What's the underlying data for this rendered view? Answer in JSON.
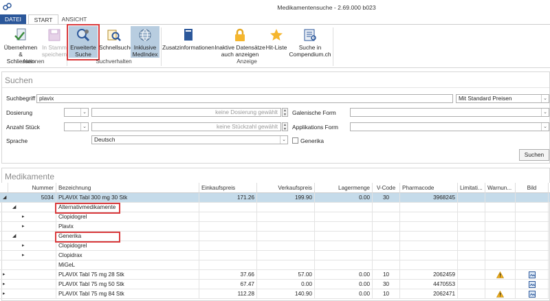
{
  "window": {
    "title": "Medikamentensuche - 2.69.000 b023"
  },
  "tabs": [
    {
      "label": "DATEI"
    },
    {
      "label": "START"
    },
    {
      "label": "ANSICHT"
    }
  ],
  "ribbon": {
    "buttons": [
      {
        "label1": "Übernehmen &",
        "label2": "Schliessen",
        "icon": "check-doc-icon"
      },
      {
        "label1": "In Stamm",
        "label2": "speichern",
        "icon": "save-icon"
      },
      {
        "label1": "Erweiterte",
        "label2": "Suche",
        "icon": "advanced-search-icon"
      },
      {
        "label1": "Schnellsuche",
        "label2": "",
        "icon": "quick-search-icon"
      },
      {
        "label1": "Inklusive",
        "label2": "MedIndex",
        "icon": "globe-icon"
      },
      {
        "label1": "Zusatzinformationen",
        "label2": "",
        "icon": "book-icon"
      },
      {
        "label1": "Inaktive Datensätze",
        "label2": "auch anzeigen",
        "icon": "lock-icon"
      },
      {
        "label1": "Hit-Liste",
        "label2": "",
        "icon": "star-icon"
      },
      {
        "label1": "Suche in",
        "label2": "Compendium.ch",
        "icon": "compendium-icon"
      }
    ],
    "groups": [
      {
        "label": "Aktionen"
      },
      {
        "label": "Suchverhalten"
      },
      {
        "label": "Anzeige"
      }
    ]
  },
  "search": {
    "title": "Suchen",
    "suchbegriff_label": "Suchbegriff",
    "suchbegriff_value": "plavix",
    "preis_value": "Mit Standard Preisen",
    "dosierung_label": "Dosierung",
    "dosierung_placeholder": "keine Dosierung gewählt",
    "anzahl_label": "Anzahl Stück",
    "anzahl_placeholder": "keine Stückzahl gewählt",
    "sprache_label": "Sprache",
    "sprache_value": "Deutsch",
    "galenische_label": "Galenische Form",
    "applikation_label": "Applikations Form",
    "generika_label": "Generika",
    "suchen_button": "Suchen"
  },
  "results": {
    "title": "Medikamente",
    "columns": [
      "Nummer",
      "Bezeichnung",
      "Einkaufspreis",
      "Verkaufspreis",
      "Lagermenge",
      "V-Code",
      "Pharmacode",
      "Limitati...",
      "Warnun...",
      "Bild"
    ],
    "rows": [
      {
        "expander": "◢",
        "nummer": "5034",
        "bez": "PLAVIX Tabl 300 mg 30 Stk",
        "ek": "171.26",
        "vk": "199.90",
        "lager": "0.00",
        "vcode": "30",
        "pharma": "3968245",
        "warn": "",
        "bild": "",
        "level": 0,
        "selected": true
      },
      {
        "expander": "◢",
        "nummer": "",
        "bez": "Alternativmedikamente",
        "ek": "",
        "vk": "",
        "lager": "",
        "vcode": "",
        "pharma": "",
        "warn": "",
        "bild": "",
        "level": 1
      },
      {
        "expander": "▸",
        "nummer": "",
        "bez": "Clopidogrel",
        "ek": "",
        "vk": "",
        "lager": "",
        "vcode": "",
        "pharma": "",
        "warn": "",
        "bild": "",
        "level": 2
      },
      {
        "expander": "▸",
        "nummer": "",
        "bez": "Plavix",
        "ek": "",
        "vk": "",
        "lager": "",
        "vcode": "",
        "pharma": "",
        "warn": "",
        "bild": "",
        "level": 2
      },
      {
        "expander": "◢",
        "nummer": "",
        "bez": "Generika",
        "ek": "",
        "vk": "",
        "lager": "",
        "vcode": "",
        "pharma": "",
        "warn": "",
        "bild": "",
        "level": 1
      },
      {
        "expander": "▸",
        "nummer": "",
        "bez": "Clopidogrel",
        "ek": "",
        "vk": "",
        "lager": "",
        "vcode": "",
        "pharma": "",
        "warn": "",
        "bild": "",
        "level": 2
      },
      {
        "expander": "▸",
        "nummer": "",
        "bez": "Clopidrax",
        "ek": "",
        "vk": "",
        "lager": "",
        "vcode": "",
        "pharma": "",
        "warn": "",
        "bild": "",
        "level": 2
      },
      {
        "expander": "",
        "nummer": "",
        "bez": "MiGeL",
        "ek": "",
        "vk": "",
        "lager": "",
        "vcode": "",
        "pharma": "",
        "warn": "",
        "bild": "",
        "level": 1
      },
      {
        "expander": "▸",
        "nummer": "",
        "bez": "PLAVIX Tabl 75 mg 28 Stk",
        "ek": "37.66",
        "vk": "57.00",
        "lager": "0.00",
        "vcode": "10",
        "pharma": "2062459",
        "warn": "warning",
        "bild": "image",
        "level": 0
      },
      {
        "expander": "▸",
        "nummer": "",
        "bez": "PLAVIX Tabl 75 mg 50 Stk",
        "ek": "67.47",
        "vk": "0.00",
        "lager": "0.00",
        "vcode": "30",
        "pharma": "4470553",
        "warn": "",
        "bild": "image",
        "level": 0
      },
      {
        "expander": "▸",
        "nummer": "",
        "bez": "PLAVIX Tabl 75 mg 84 Stk",
        "ek": "112.28",
        "vk": "140.90",
        "lager": "0.00",
        "vcode": "10",
        "pharma": "2062471",
        "warn": "warning",
        "bild": "image",
        "level": 0
      }
    ]
  },
  "colors": {
    "accent": "#2b579a",
    "highlight": "#d9383a",
    "selected_row": "#c5dbea"
  }
}
